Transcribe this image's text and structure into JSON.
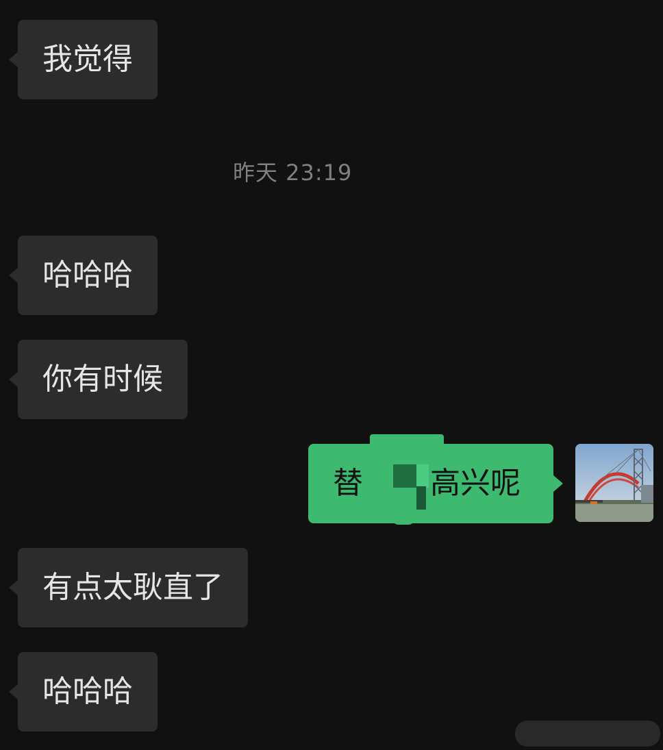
{
  "chat": {
    "timestamp": "昨天 23:19",
    "messages": [
      {
        "side": "incoming",
        "text": "我觉得"
      },
      {
        "side": "incoming",
        "text": "哈哈哈"
      },
      {
        "side": "incoming",
        "text": "你有时候"
      },
      {
        "side": "outgoing",
        "text_before": "替",
        "text_after": "高兴呢"
      },
      {
        "side": "incoming",
        "text": "有点太耿直了"
      },
      {
        "side": "incoming",
        "text": "哈哈哈"
      }
    ]
  },
  "colors": {
    "background": "#111111",
    "incoming_bubble": "#2c2c2c",
    "outgoing_bubble": "#3dba6f",
    "timestamp_text": "#808080"
  },
  "icons": {
    "avatar": "bridge-photo-avatar",
    "redaction": "pixelated-redaction"
  }
}
